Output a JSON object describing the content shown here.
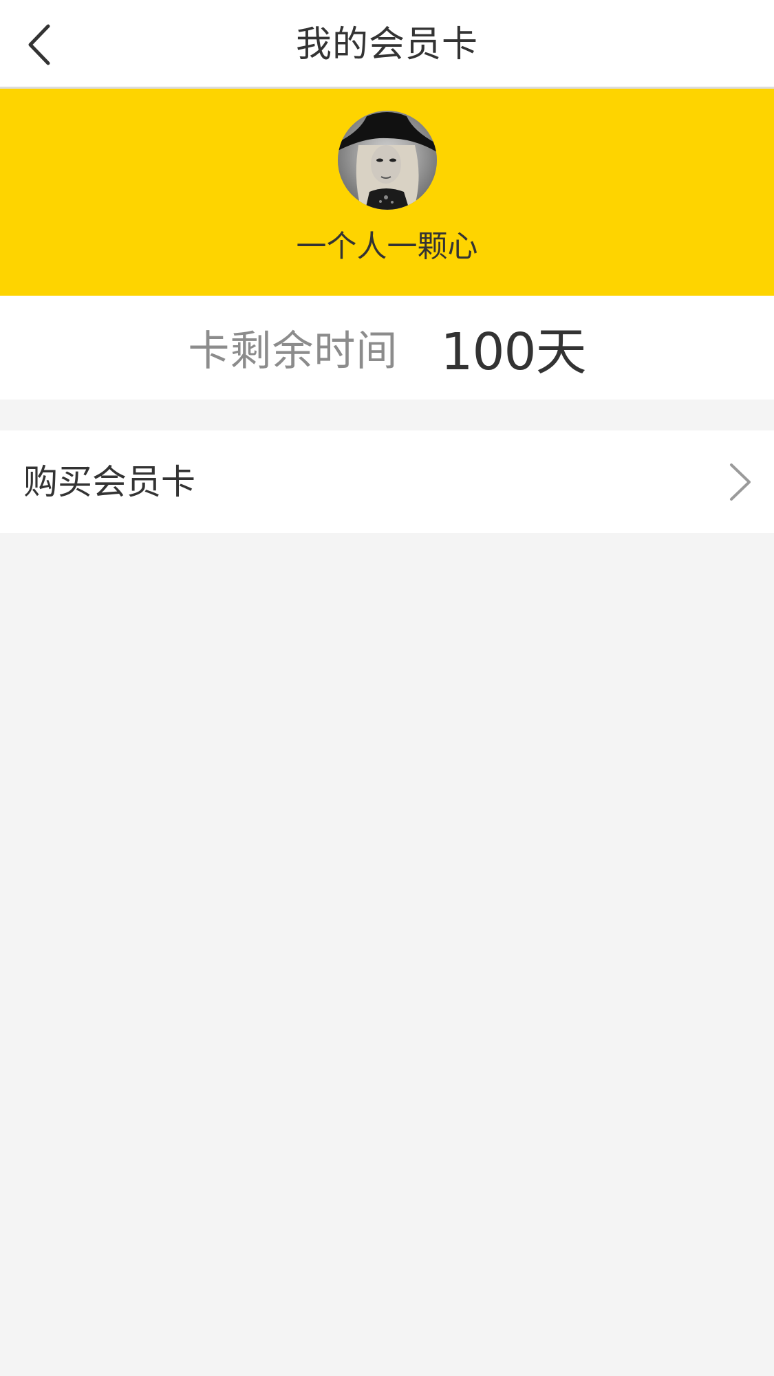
{
  "header": {
    "title": "我的会员卡",
    "back_icon": "chevron-left-icon"
  },
  "profile": {
    "background_color": "#fed400",
    "avatar_icon": "avatar-photo",
    "nickname": "一个人一颗心"
  },
  "membership": {
    "remaining_label": "卡剩余时间",
    "remaining_value": "100天"
  },
  "menu": {
    "buy_label": "购买会员卡",
    "buy_icon": "chevron-right-icon"
  }
}
